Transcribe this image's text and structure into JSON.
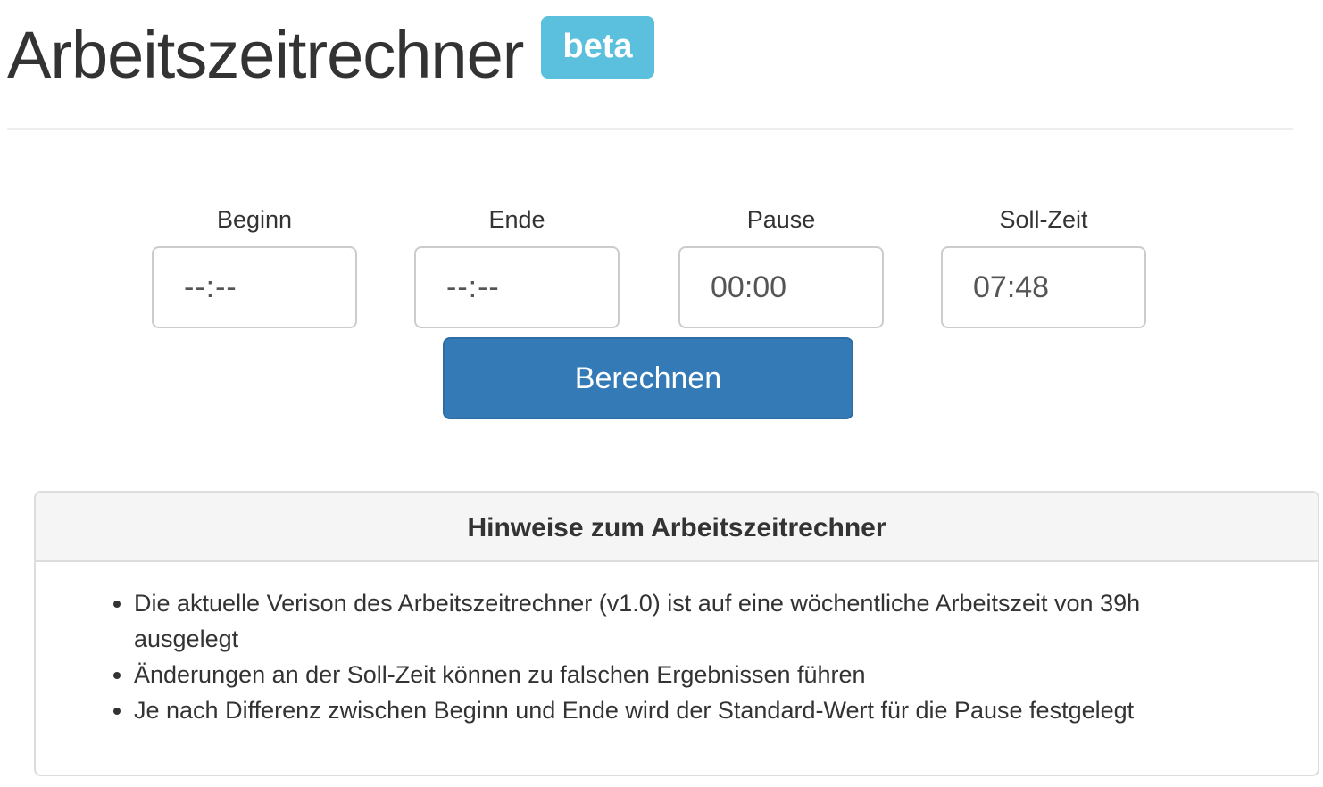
{
  "header": {
    "title": "Arbeitszeitrechner",
    "badge": "beta"
  },
  "form": {
    "fields": [
      {
        "label": "Beginn",
        "value": "--:--"
      },
      {
        "label": "Ende",
        "value": "--:--"
      },
      {
        "label": "Pause",
        "value": "00:00"
      },
      {
        "label": "Soll-Zeit",
        "value": "07:48"
      }
    ],
    "submit_label": "Berechnen"
  },
  "notes": {
    "heading": "Hinweise zum Arbeitszeitrechner",
    "items": [
      "Die aktuelle Verison des Arbeitszeitrechner (v1.0) ist auf eine wöchentliche Arbeitszeit von 39h ausgelegt",
      "Änderungen an der Soll-Zeit können zu falschen Ergebnissen führen",
      "Je nach Differenz zwischen Beginn und Ende wird der Standard-Wert für die Pause festgelegt"
    ]
  },
  "colors": {
    "badge": "#5bc0de",
    "primary_button": "#337ab7",
    "text": "#333333",
    "panel_heading_bg": "#f5f5f5"
  }
}
